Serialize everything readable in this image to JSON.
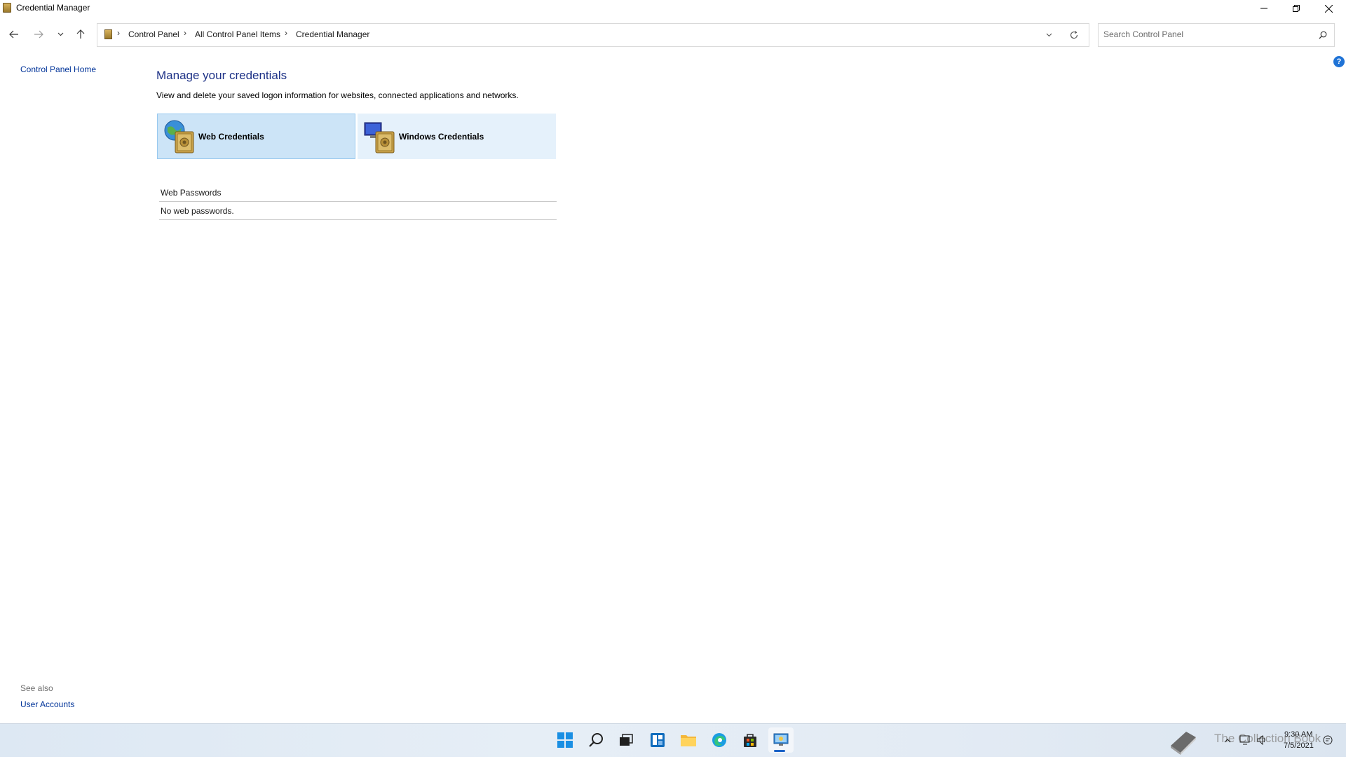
{
  "window": {
    "title": "Credential Manager",
    "minimize_icon": "minimize-icon",
    "maximize_icon": "restore-icon",
    "close_icon": "close-icon"
  },
  "nav": {
    "back_icon": "back-arrow-icon",
    "forward_icon": "forward-arrow-icon",
    "recent_icon": "chevron-down-icon",
    "up_icon": "up-arrow-icon"
  },
  "address": {
    "crumbs": [
      "Control Panel",
      "All Control Panel Items",
      "Credential Manager"
    ],
    "separator": "›"
  },
  "search": {
    "placeholder": "Search Control Panel"
  },
  "sidebar": {
    "home_link": "Control Panel Home",
    "see_also": "See also",
    "user_accounts": "User Accounts"
  },
  "main": {
    "title": "Manage your credentials",
    "description": "View and delete your saved logon information for websites, connected applications and networks.",
    "tiles": [
      {
        "label": "Web Credentials",
        "selected": true
      },
      {
        "label": "Windows Credentials",
        "selected": false
      }
    ],
    "section_header": "Web Passwords",
    "empty_text": "No web passwords."
  },
  "help": {
    "glyph": "?"
  },
  "taskbar": {
    "icons": [
      "windows-start-icon",
      "search-icon",
      "task-view-icon",
      "widgets-icon",
      "file-explorer-icon",
      "edge-icon",
      "store-icon",
      "control-panel-icon"
    ],
    "active": "control-panel-icon",
    "clock_time": "9:30 AM",
    "clock_date": "7/5/2021",
    "watermark": "The Collection Book"
  },
  "colors": {
    "link": "#003399",
    "title_blue": "#1e3287",
    "tile_selected": "#cce4f7",
    "tile_hover": "#e5f1fb",
    "accent": "#1a62c7"
  }
}
